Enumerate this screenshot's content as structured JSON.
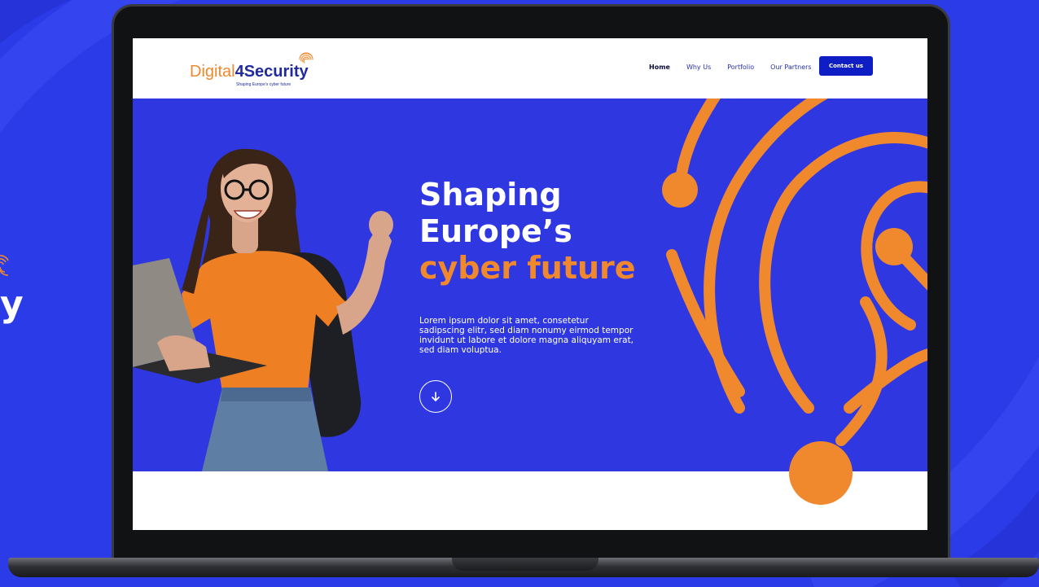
{
  "site": {
    "brand": {
      "name_part1": "Digital",
      "name_part2": "4Security",
      "tagline": "Shaping Europe's cyber future",
      "logo_icon": "fingerprint-icon"
    },
    "nav": {
      "items": [
        {
          "label": "Home",
          "active": true
        },
        {
          "label": "Why Us",
          "active": false
        },
        {
          "label": "Portfolio",
          "active": false
        },
        {
          "label": "Our Partners",
          "active": false
        }
      ],
      "cta_label": "Contact us"
    },
    "hero": {
      "title_line1": "Shaping",
      "title_line2": "Europe’s",
      "title_accent": "cyber future",
      "body": "Lorem ipsum dolor sit amet, consetetur sadipscing elitr, sed diam nonumy eirmod tempor invidunt ut labore et dolore magna aliquyam erat, sed diam voluptua.",
      "scroll_icon": "arrow-down-icon"
    }
  },
  "side_logo_glyph": "y",
  "colors": {
    "background": "#2b3be8",
    "hero_bg": "#2f38e0",
    "accent_orange": "#f0892d",
    "brand_navy": "#1f2a9e",
    "cta_blue": "#0f1ec4",
    "white": "#ffffff"
  }
}
